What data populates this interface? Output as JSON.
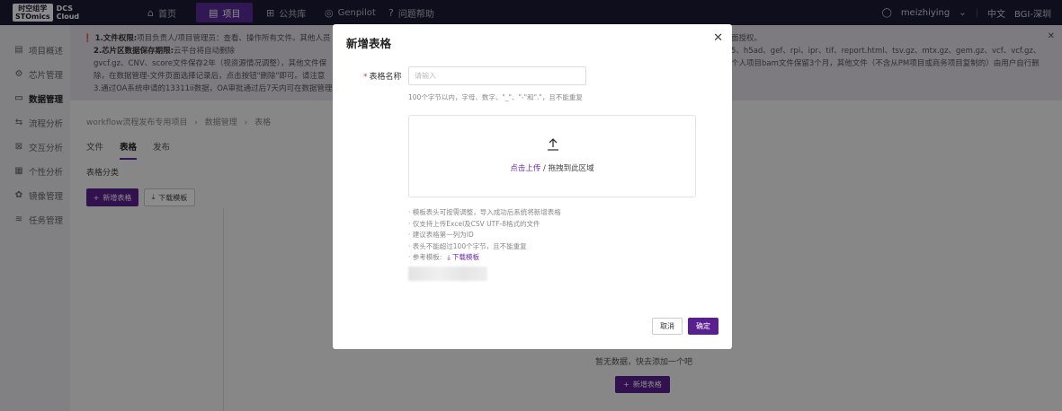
{
  "logo": {
    "cn": "时空组学",
    "en": "STOmics",
    "product": "DCS",
    "product2": "Cloud"
  },
  "nav": [
    {
      "label": "首页",
      "icon": "home-icon",
      "glyph": "⌂"
    },
    {
      "label": "项目",
      "icon": "document-icon",
      "glyph": "▤"
    },
    {
      "label": "公共库",
      "icon": "grid-icon",
      "glyph": "⊞"
    },
    {
      "label": "Genpilot",
      "icon": "target-icon",
      "glyph": "◎"
    },
    {
      "label": "问题帮助",
      "icon": "help-icon",
      "glyph": "?"
    }
  ],
  "user": {
    "name": "meizhiying",
    "lang": "中文",
    "org": "BGI-深圳"
  },
  "sidebar": [
    {
      "label": "项目概述",
      "glyph": "▤"
    },
    {
      "label": "芯片管理",
      "glyph": "⚙"
    },
    {
      "label": "数据管理",
      "glyph": "▭"
    },
    {
      "label": "流程分析",
      "glyph": "⇆"
    },
    {
      "label": "交互分析",
      "glyph": "⊠"
    },
    {
      "label": "个性分析",
      "glyph": "▦"
    },
    {
      "label": "镜像管理",
      "glyph": "✿"
    },
    {
      "label": "任务管理",
      "glyph": "≋"
    }
  ],
  "notice": {
    "line1_bold": "1.文件权限:",
    "line1": "项目负责人/项目管理员：查看、操作所有文件。其他人员",
    "line1_tail": "面授权。",
    "line2_bold": "2.芯片区数据保存期限:",
    "line2": "云平台将自动删除",
    "line2_tail": "5、h5ad、gef、rpi、ipr、tif、report.html、tsv.gz、mtx.gz、gem.gz、vcf、vcf.gz、",
    "line3": "gvcf.gz、CNV、score文件保存2年（视资源情况调整），其他文件保",
    "line3_tail": "个人项目bam文件保留3个月，其他文件（不含从PM项目或商务项目复制的）由用户自行删",
    "line4": "除，在数据管理-文件页面选择记录后，点击按钮\"删除\"即可。请注意",
    "line5": "3.通过OA系统申请的13311ii数据，OA审批通过后7天内可在数据管理-"
  },
  "breadcrumb": {
    "a": "workflow流程发布专用项目",
    "b": "数据管理",
    "c": "表格"
  },
  "tabs": [
    "文件",
    "表格",
    "发布"
  ],
  "subcategory": "表格分类",
  "buttons": {
    "add_table": "新增表格",
    "download_template": "下载模板"
  },
  "empty": "暂无数据，快去添加一个吧",
  "modal": {
    "title": "新增表格",
    "name_label": "表格名称",
    "name_placeholder": "请输入",
    "name_value": "",
    "hint": "100个字节以内，字母、数字、\"_\"、\"-\"和\".\"，且不能重复",
    "upload_link": "点击上传",
    "upload_rest": " / 拖拽到此区域",
    "notes": [
      "模板表头可按需调整，导入成功后系统将新增表格",
      "仅支持上传Excel及CSV UTF-8格式的文件",
      "建议表格第一列为ID",
      "表头不能超过100个字节，且不能重复"
    ],
    "ref_label": "参考模板:",
    "ref_link": "下载模板",
    "cancel": "取消",
    "ok": "确定"
  }
}
